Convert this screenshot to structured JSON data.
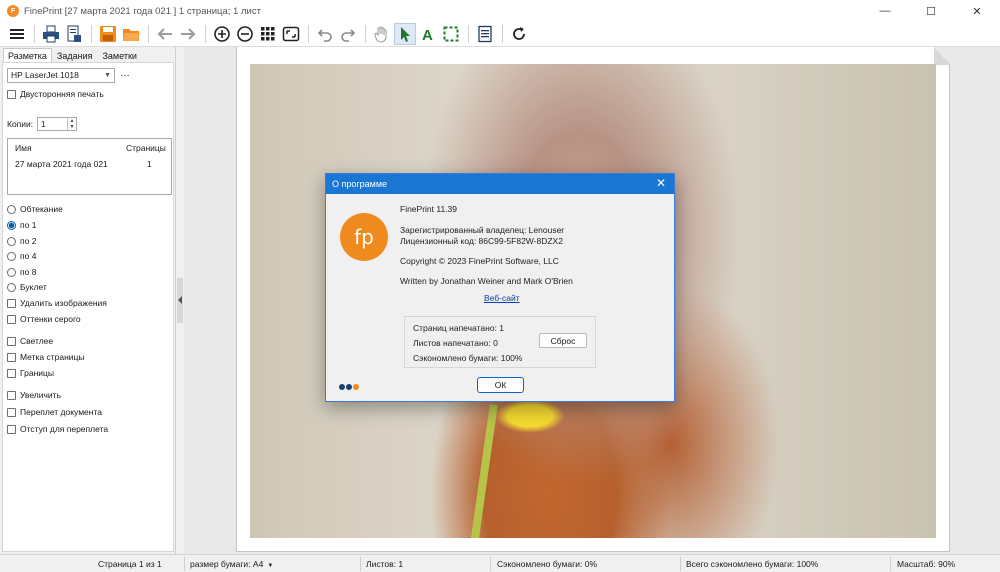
{
  "window": {
    "title": "FinePrint [27 марта 2021 года 021 ] 1 страница; 1 лист",
    "app_icon": "fineprint-app-icon",
    "controls": [
      "minimize",
      "maximize",
      "close"
    ]
  },
  "toolbar": {
    "buttons": [
      "menu-icon",
      "print-icon",
      "print-settings-icon",
      "save-icon",
      "open-folder-icon",
      "back-arrow-icon",
      "forward-arrow-icon",
      "zoom-in-icon",
      "zoom-out-icon",
      "grid-view-icon",
      "fit-page-icon",
      "undo-icon",
      "redo-icon",
      "hand-icon",
      "pointer-icon",
      "text-tool-icon",
      "select-area-icon",
      "document-icon",
      "refresh-icon"
    ],
    "active": "pointer-icon"
  },
  "left_panel": {
    "tabs": [
      {
        "label": "Разметка",
        "active": true
      },
      {
        "label": "Задания",
        "active": false
      },
      {
        "label": "Заметки",
        "active": false
      }
    ],
    "printer": "HP LaserJet 1018",
    "more_label": "…",
    "duplex_label": "Двусторонняя печать",
    "copies_label": "Копии:",
    "copies_value": "1",
    "jobs_table": {
      "headers": [
        "Имя",
        "Страницы"
      ],
      "rows": [
        [
          "27 марта 2021 года 021",
          "1"
        ]
      ]
    },
    "layout_options": [
      {
        "label": "Обтекание",
        "checked": false
      },
      {
        "label": "по 1",
        "checked": true
      },
      {
        "label": "по 2",
        "checked": false
      },
      {
        "label": "по 4",
        "checked": false
      },
      {
        "label": "по 8",
        "checked": false
      },
      {
        "label": "Буклет",
        "checked": false
      }
    ],
    "checkboxes_a": [
      "Удалить изображения",
      "Оттенки серого"
    ],
    "checkboxes_b": [
      "Светлее",
      "Метка страницы",
      "Границы"
    ],
    "checkboxes_c": [
      "Увеличить",
      "Переплет документа",
      "Отступ для переплета"
    ]
  },
  "dialog": {
    "title": "О программе",
    "logo_text": "fp",
    "version": "FinePrint 11.39",
    "owner": "Зарегистрированный владелец:  Lenouser",
    "license": "Лицензионный код:  86C99-5F82W-8DZX2",
    "copyright": "Copyright © 2023 FinePrint Software, LLC",
    "authors": "Written by Jonathan Weiner and Mark O'Brien",
    "website": "Веб-сайт",
    "stats": {
      "pages_printed": "Страниц напечатано:  1",
      "sheets_printed": "Листов напечатано:    0",
      "paper_saved": "Сэкономлено бумаги:  100%"
    },
    "reset_label": "Сброс",
    "ok_label": "ОК",
    "dot_colors": [
      "#1b3f73",
      "#1b3f73",
      "#ef8a1e"
    ]
  },
  "statusbar": {
    "page": "Страница 1 из 1",
    "paper_size": "размер бумаги: A4",
    "sheets": "Листов: 1",
    "saved": "Сэкономлено бумаги: 0%",
    "total_saved": "Всего сэкономлено бумаги: 100%",
    "zoom": "Масштаб: 90%"
  }
}
